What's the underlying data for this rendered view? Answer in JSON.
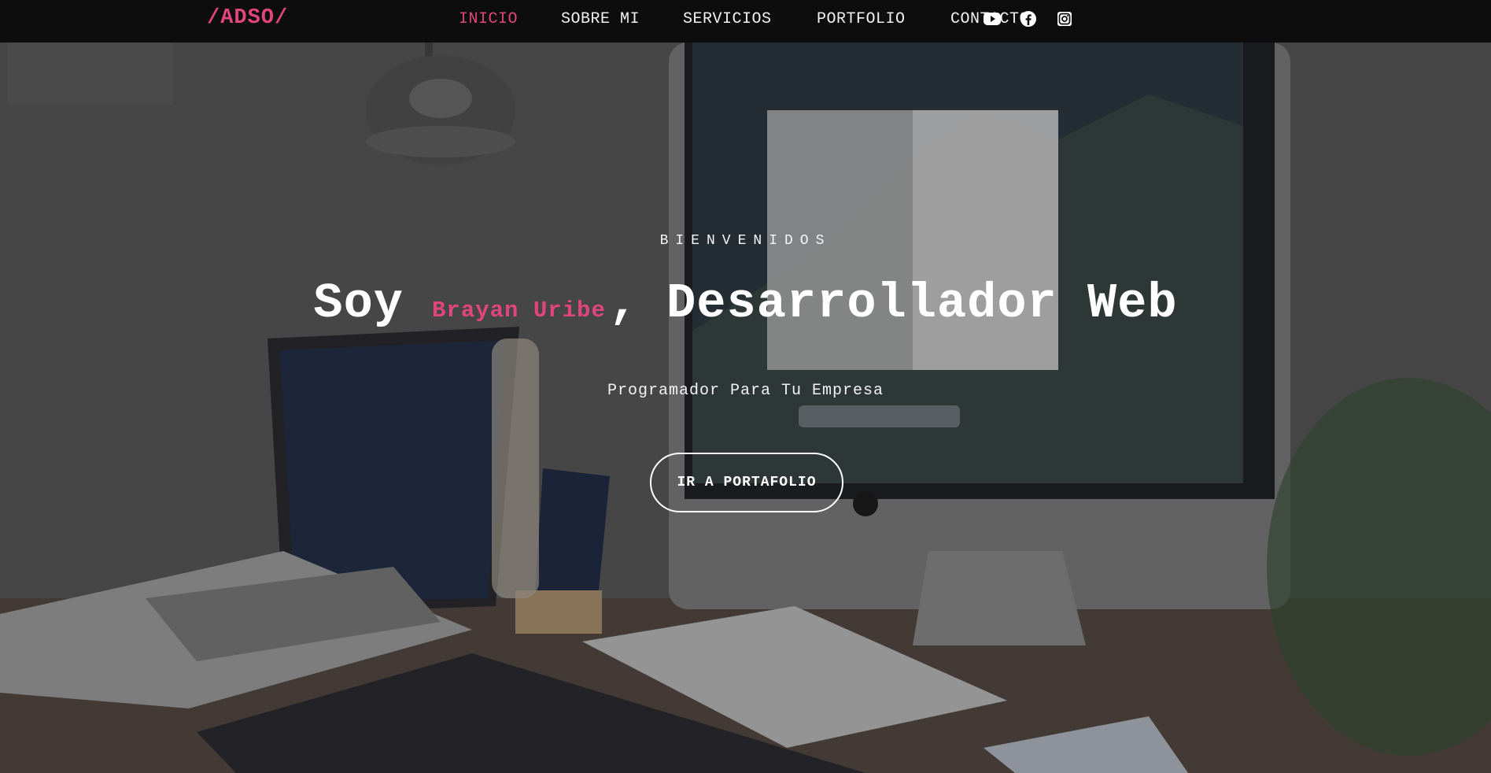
{
  "colors": {
    "accent": "#e0457b",
    "navbar_bg": "#0d0d0d",
    "text": "#ffffff"
  },
  "navbar": {
    "brand": "/ADSO/",
    "items": [
      {
        "label": "INICIO",
        "active": true
      },
      {
        "label": "SOBRE MI",
        "active": false
      },
      {
        "label": "SERVICIOS",
        "active": false
      },
      {
        "label": "PORTFOLIO",
        "active": false
      },
      {
        "label": "CONTACTO",
        "active": false
      }
    ],
    "social": [
      {
        "icon": "youtube-icon"
      },
      {
        "icon": "facebook-icon"
      },
      {
        "icon": "instagram-icon"
      }
    ]
  },
  "hero": {
    "eyebrow": "BIENVENIDOS",
    "headline_prefix": "Soy",
    "name": "Brayan Uribe",
    "comma": ",",
    "headline_role": "Desarrollador Web",
    "subtitle": "Programador Para Tu Empresa",
    "cta_label": "IR A PORTAFOLIO"
  }
}
